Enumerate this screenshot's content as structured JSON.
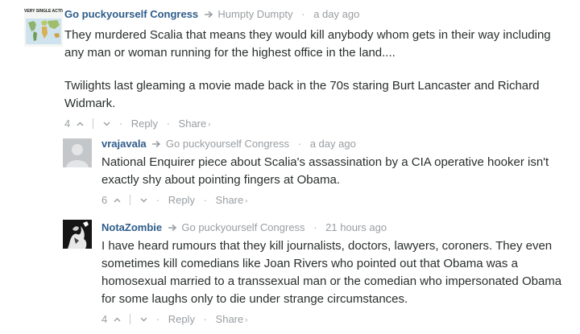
{
  "comments": [
    {
      "author": "Go puckyourself Congress",
      "reply_to": "Humpty Dumpty",
      "time": "a day ago",
      "avatar_text": "VERY SINGLE ACTIVI",
      "paragraphs": [
        "They murdered Scalia that means they would kill anybody whom gets in their way including any man or woman running for the highest office in the land....",
        "Twilights last gleaming a movie made back in the 70s staring Burt Lancaster and Richard Widmark."
      ],
      "upvotes": "4",
      "reply_label": "Reply",
      "share_label": "Share",
      "share_caret": "›"
    },
    {
      "author": "vrajavala",
      "reply_to": "Go puckyourself Congress",
      "time": "a day ago",
      "paragraphs": [
        "National Enquirer piece about Scalia's assassination by a CIA operative hooker isn't exactly shy about pointing fingers at Obama."
      ],
      "upvotes": "6",
      "reply_label": "Reply",
      "share_label": "Share",
      "share_caret": "›"
    },
    {
      "author": "NotaZombie",
      "reply_to": "Go puckyourself Congress",
      "time": "21 hours ago",
      "paragraphs": [
        "I have heard rumours that they kill journalists, doctors, lawyers, coroners. They even sometimes kill comedians like Joan Rivers who pointed out that Obama was a homosexual married to a transsexual man or the comedian who impersonated Obama for some laughs only to die under strange circumstances."
      ],
      "upvotes": "4",
      "reply_label": "Reply",
      "share_label": "Share",
      "share_caret": "›"
    }
  ],
  "separator": "·",
  "colors": {
    "author": "#2e5c8a",
    "muted": "#999da1",
    "text": "#2a2e2e"
  }
}
